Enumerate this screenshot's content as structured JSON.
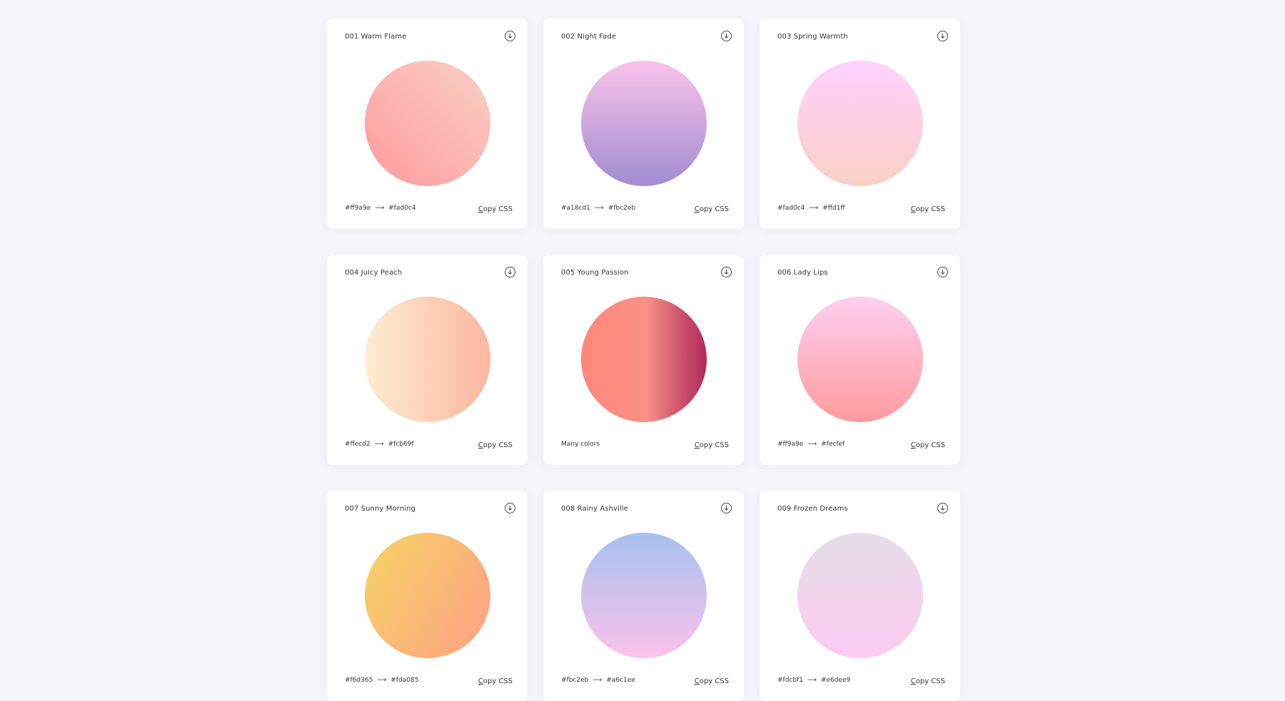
{
  "gradients": [
    {
      "title": "001 Warm Flame",
      "from": "#ff9a9e",
      "to": "#fad0c4",
      "arrow": "⟶",
      "copy_label": "Copy CSS",
      "css": "linear-gradient(45deg, #ff9a9e 0%, #fad0c4 99%, #fad0c4 100%)",
      "icon": "download-icon"
    },
    {
      "title": "002 Night Fade",
      "from": "#a18cd1",
      "to": "#fbc2eb",
      "arrow": "⟶",
      "copy_label": "Copy CSS",
      "css": "linear-gradient(to top, #a18cd1 0%, #fbc2eb 100%)",
      "icon": "download-icon"
    },
    {
      "title": "003 Spring Warmth",
      "from": "#fad0c4",
      "to": "#ffd1ff",
      "arrow": "⟶",
      "copy_label": "Copy CSS",
      "css": "linear-gradient(to top, #fad0c4 0%, #ffd1ff 100%)",
      "icon": "download-icon"
    },
    {
      "title": "004 Juicy Peach",
      "from": "#ffecd2",
      "to": "#fcb69f",
      "arrow": "⟶",
      "copy_label": "Copy CSS",
      "css": "linear-gradient(to right, #ffecd2 0%, #fcb69f 100%)",
      "icon": "download-icon"
    },
    {
      "title": "005 Young Passion",
      "many_label": "Many colors",
      "copy_label": "Copy CSS",
      "css": "linear-gradient(to right, #ff8177 0%, #ff867a 0%, #ff8c7f 21%, #f99185 52%, #cf556c 78%, #b12a5b 100%)",
      "icon": "download-icon"
    },
    {
      "title": "006 Lady Lips",
      "from": "#ff9a9e",
      "to": "#fecfef",
      "arrow": "⟶",
      "copy_label": "Copy CSS",
      "css": "linear-gradient(to top, #ff9a9e 0%, #fecfef 99%, #fecfef 100%)",
      "icon": "download-icon"
    },
    {
      "title": "007 Sunny Morning",
      "from": "#f6d365",
      "to": "#fda085",
      "arrow": "⟶",
      "copy_label": "Copy CSS",
      "css": "linear-gradient(120deg, #f6d365 0%, #fda085 100%)",
      "icon": "download-icon"
    },
    {
      "title": "008 Rainy Ashville",
      "from": "#fbc2eb",
      "to": "#a6c1ee",
      "arrow": "⟶",
      "copy_label": "Copy CSS",
      "css": "linear-gradient(to top, #fbc2eb 0%, #a6c1ee 100%)",
      "icon": "download-icon"
    },
    {
      "title": "009 Frozen Dreams",
      "from": "#fdcbf1",
      "to": "#e6dee9",
      "arrow": "⟶",
      "copy_label": "Copy CSS",
      "css": "linear-gradient(to top, #fdcbf1 0%, #fdcbf1 1%, #e6dee9 100%)",
      "icon": "download-icon"
    }
  ]
}
